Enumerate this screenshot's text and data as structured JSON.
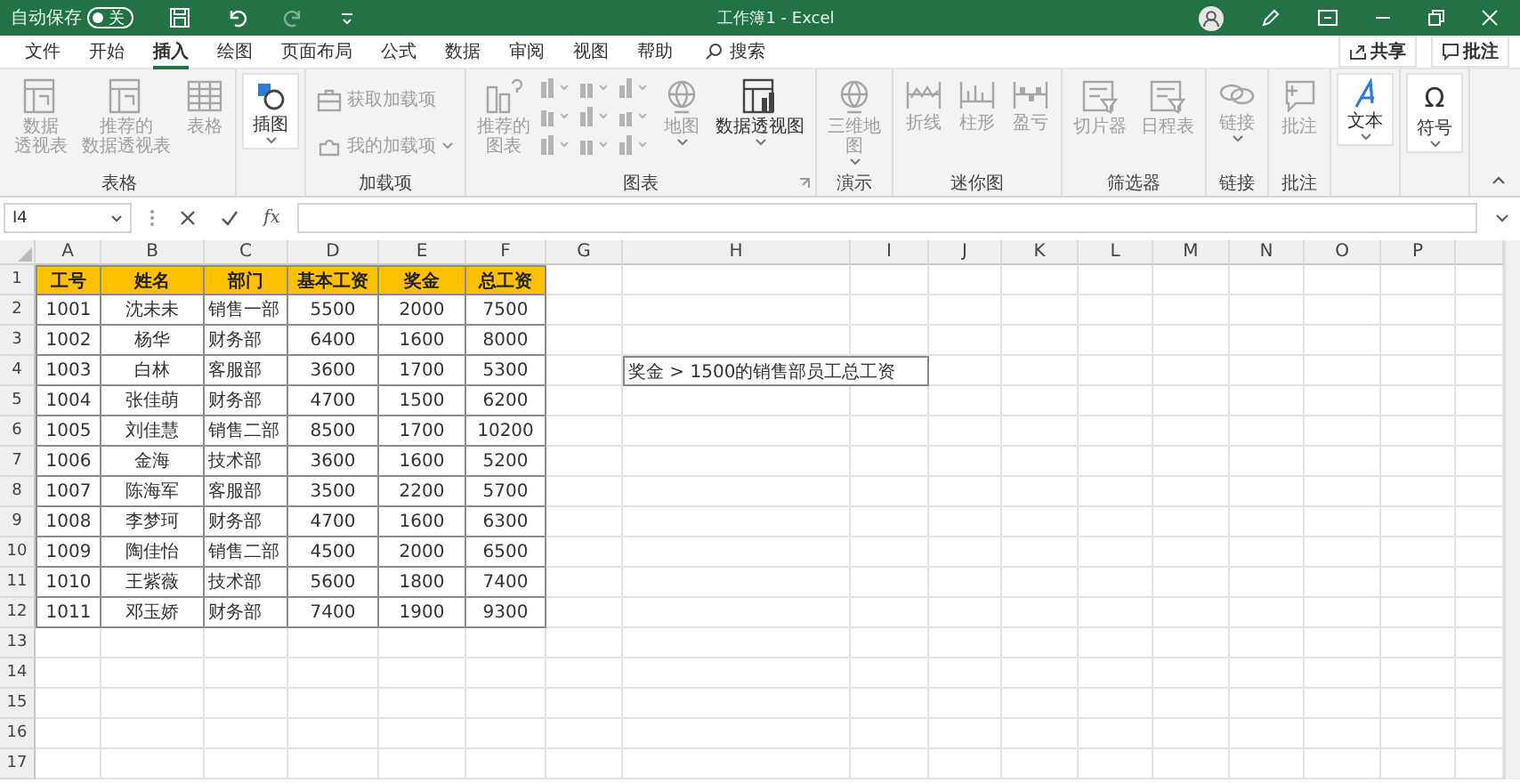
{
  "title_bar": {
    "autosave": {
      "label": "自动保存",
      "on": false,
      "state_text": "关"
    },
    "quick_access": [
      {
        "kind": "save",
        "disabled": false
      },
      {
        "kind": "undo",
        "disabled": false
      },
      {
        "kind": "redo",
        "disabled": true
      },
      {
        "kind": "customize",
        "disabled": false
      }
    ],
    "title": "工作簿1  -  Excel"
  },
  "menu": {
    "tabs": [
      {
        "label": "文件",
        "selected": false
      },
      {
        "label": "开始",
        "selected": false
      },
      {
        "label": "插入",
        "selected": true
      },
      {
        "label": "绘图",
        "selected": false
      },
      {
        "label": "页面布局",
        "selected": false
      },
      {
        "label": "公式",
        "selected": false
      },
      {
        "label": "数据",
        "selected": false
      },
      {
        "label": "审阅",
        "selected": false
      },
      {
        "label": "视图",
        "selected": false
      },
      {
        "label": "帮助",
        "selected": false
      }
    ],
    "search": "搜索",
    "share": "共享",
    "comments": "批注"
  },
  "ribbon": {
    "groups": [
      {
        "label": "表格",
        "items": [
          {
            "kind": "large",
            "lines": [
              "数据",
              "透视表"
            ],
            "disabled": true
          },
          {
            "kind": "large",
            "lines": [
              "推荐的",
              "数据透视表"
            ],
            "disabled": true
          },
          {
            "kind": "large",
            "lines": [
              "表格"
            ],
            "disabled": true
          }
        ]
      },
      {
        "items": [
          {
            "kind": "boxed",
            "lines": [
              "插图"
            ],
            "disabled": false,
            "dropdown": true
          }
        ]
      },
      {
        "label": "加载项",
        "items": [
          {
            "kind": "small",
            "label": "获取加载项",
            "disabled": true
          },
          {
            "kind": "small",
            "label": "我的加载项",
            "disabled": true,
            "dropdown": true
          }
        ]
      },
      {
        "label": "图表",
        "launcher": true,
        "items": [
          {
            "kind": "large",
            "lines": [
              "推荐的",
              "图表"
            ],
            "disabled": true
          },
          {
            "kind": "gallery",
            "disabled": true
          },
          {
            "kind": "large",
            "lines": [
              "地图"
            ],
            "disabled": true,
            "dropdown": true
          },
          {
            "kind": "large",
            "lines": [
              "数据透视图"
            ],
            "disabled": false,
            "dropdown": true
          }
        ]
      },
      {
        "label": "演示",
        "items": [
          {
            "kind": "large",
            "lines": [
              "三维地",
              "图"
            ],
            "disabled": true,
            "dropdown": true
          }
        ]
      },
      {
        "label": "迷你图",
        "items": [
          {
            "kind": "large",
            "lines": [
              "折线"
            ],
            "disabled": true
          },
          {
            "kind": "large",
            "lines": [
              "柱形"
            ],
            "disabled": true
          },
          {
            "kind": "large",
            "lines": [
              "盈亏"
            ],
            "disabled": true
          }
        ]
      },
      {
        "label": "筛选器",
        "items": [
          {
            "kind": "large",
            "lines": [
              "切片器"
            ],
            "disabled": true
          },
          {
            "kind": "large",
            "lines": [
              "日程表"
            ],
            "disabled": true
          }
        ]
      },
      {
        "label": "链接",
        "items": [
          {
            "kind": "large",
            "lines": [
              "链接"
            ],
            "disabled": true,
            "dropdown": true
          }
        ]
      },
      {
        "label": "批注",
        "items": [
          {
            "kind": "large",
            "lines": [
              "批注"
            ],
            "disabled": true
          }
        ]
      },
      {
        "items": [
          {
            "kind": "boxed",
            "lines": [
              "文本"
            ],
            "disabled": false,
            "dropdown": true
          }
        ]
      },
      {
        "items": [
          {
            "kind": "boxed",
            "lines": [
              "符号"
            ],
            "disabled": false,
            "dropdown": true,
            "glyph": "Ω"
          }
        ]
      }
    ]
  },
  "formula_bar": {
    "name_box": "I4",
    "fx": "fx"
  },
  "sheet": {
    "column_letters": [
      "A",
      "B",
      "C",
      "D",
      "E",
      "F",
      "G",
      "H",
      "I",
      "J",
      "K",
      "L",
      "M",
      "N",
      "O",
      "P"
    ],
    "row_numbers": [
      "1",
      "2",
      "3",
      "4",
      "5",
      "6",
      "7",
      "8",
      "9",
      "10",
      "11",
      "12",
      "13",
      "14",
      "15",
      "16",
      "17"
    ],
    "table": {
      "columns": [
        "工号",
        "姓名",
        "部门",
        "基本工资",
        "奖金",
        "总工资"
      ],
      "rows": [
        [
          "1001",
          "沈未未",
          "销售一部",
          "5500",
          "2000",
          "7500"
        ],
        [
          "1002",
          "杨华",
          "财务部",
          "6400",
          "1600",
          "8000"
        ],
        [
          "1003",
          "白林",
          "客服部",
          "3600",
          "1700",
          "5300"
        ],
        [
          "1004",
          "张佳萌",
          "财务部",
          "4700",
          "1500",
          "6200"
        ],
        [
          "1005",
          "刘佳慧",
          "销售二部",
          "8500",
          "1700",
          "10200"
        ],
        [
          "1006",
          "金海",
          "技术部",
          "3600",
          "1600",
          "5200"
        ],
        [
          "1007",
          "陈海军",
          "客服部",
          "3500",
          "2200",
          "5700"
        ],
        [
          "1008",
          "李梦珂",
          "财务部",
          "4700",
          "1600",
          "6300"
        ],
        [
          "1009",
          "陶佳怡",
          "销售二部",
          "4500",
          "2000",
          "6500"
        ],
        [
          "1010",
          "王紫薇",
          "技术部",
          "5600",
          "1800",
          "7400"
        ],
        [
          "1011",
          "邓玉娇",
          "财务部",
          "7400",
          "1900",
          "9300"
        ]
      ]
    },
    "note_cell": {
      "text": "奖金 > 1500的销售部员工总工资"
    }
  }
}
